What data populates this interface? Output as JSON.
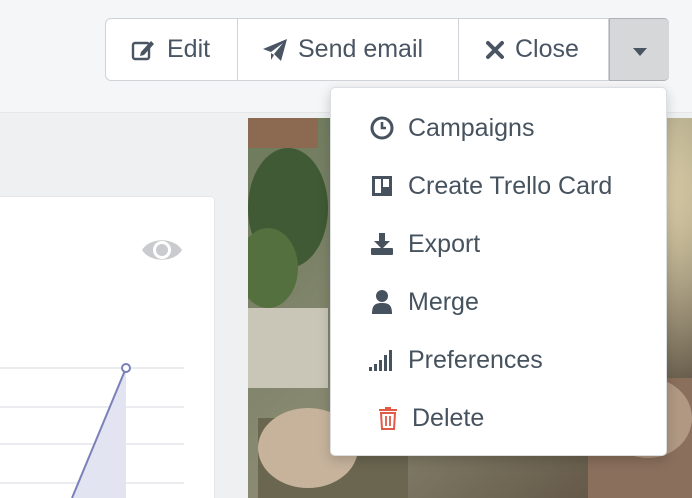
{
  "toolbar": {
    "edit_label": "Edit",
    "send_email_label": "Send email",
    "close_label": "Close"
  },
  "dropdown": {
    "items": [
      {
        "label": "Campaigns",
        "icon": "clock-icon"
      },
      {
        "label": "Create Trello Card",
        "icon": "trello-icon"
      },
      {
        "label": "Export",
        "icon": "download-icon"
      },
      {
        "label": "Merge",
        "icon": "user-icon"
      },
      {
        "label": "Preferences",
        "icon": "signal-bars-icon"
      },
      {
        "label": "Delete",
        "icon": "trash-icon"
      }
    ]
  },
  "colors": {
    "text": "#4a5563",
    "danger": "#e05a46",
    "chart_line": "#7a80b8"
  }
}
